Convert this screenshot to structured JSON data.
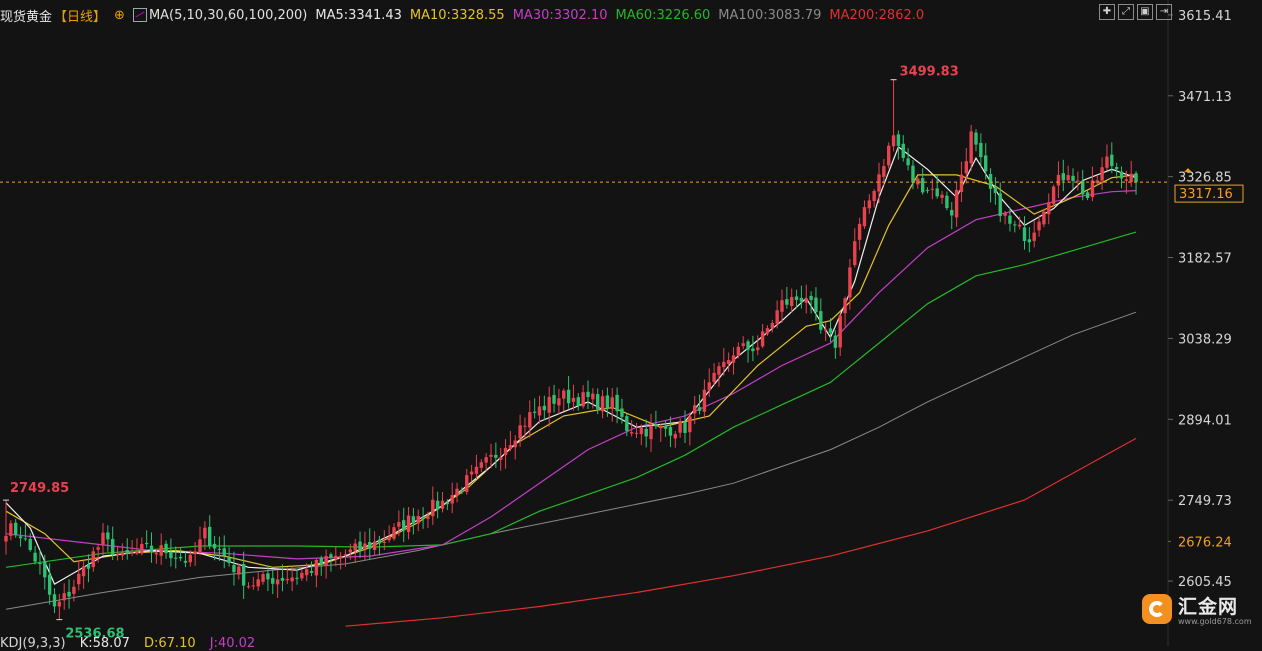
{
  "header": {
    "title": "现货黄金",
    "period": "【日线】",
    "add_symbol": "⊕",
    "ma_label": "MA(5,10,30,60,100,200)",
    "ma5": "MA5:3341.43",
    "ma10": "MA10:3328.55",
    "ma30": "MA30:3302.10",
    "ma60": "MA60:3226.60",
    "ma100": "MA100:3083.79",
    "ma200": "MA200:2862.0"
  },
  "colors": {
    "background": "#131313",
    "up": "#e8424e",
    "down": "#2fbf71",
    "ma5": "#f0f0f0",
    "ma10": "#e6c229",
    "ma30": "#c53ec9",
    "ma60": "#25b825",
    "ma100": "#8a8a8a",
    "ma200": "#e0302f",
    "last_price": "#f0a020"
  },
  "toolbar": [
    "crosshair-icon",
    "expand-icon",
    "image-icon",
    "exit-icon"
  ],
  "kdj": {
    "label": "KDJ(9,3,3)",
    "k": "K:58.07",
    "d": "D:67.10",
    "j": "J:40.02"
  },
  "logo": {
    "name": "汇金网",
    "url": "www.gold678.com"
  },
  "chart_data": {
    "type": "candlestick",
    "ylim": [
      2536,
      3642
    ],
    "yticks": [
      3615.41,
      3471.13,
      3326.85,
      3182.57,
      3038.29,
      2894.01,
      2749.73,
      2605.45
    ],
    "ytick_labels": [
      "3615.41",
      "3471.13",
      "3326.85",
      "3182.57",
      "3038.29",
      "2894.01",
      "2749.73",
      "2605.45"
    ],
    "last_price": 3317.16,
    "last_price_label": "3317.16",
    "marker_price": 2676.24,
    "marker_price_label": "2676.24",
    "high_label": "3499.83",
    "high_value": 3499.83,
    "high_index": 183,
    "left_high_label": "2749.85",
    "left_high_value": 2749.85,
    "left_high_index": 0,
    "low_label": "2536.68",
    "low_value": 2536.68,
    "low_index": 11,
    "anchors": [
      [
        0,
        2700
      ],
      [
        3,
        2690
      ],
      [
        7,
        2630
      ],
      [
        10,
        2555
      ],
      [
        13,
        2585
      ],
      [
        17,
        2640
      ],
      [
        20,
        2680
      ],
      [
        24,
        2645
      ],
      [
        28,
        2660
      ],
      [
        33,
        2660
      ],
      [
        38,
        2640
      ],
      [
        41,
        2690
      ],
      [
        45,
        2650
      ],
      [
        50,
        2600
      ],
      [
        55,
        2610
      ],
      [
        60,
        2615
      ],
      [
        66,
        2640
      ],
      [
        72,
        2660
      ],
      [
        78,
        2680
      ],
      [
        84,
        2720
      ],
      [
        90,
        2745
      ],
      [
        96,
        2790
      ],
      [
        102,
        2840
      ],
      [
        108,
        2900
      ],
      [
        114,
        2935
      ],
      [
        120,
        2930
      ],
      [
        125,
        2920
      ],
      [
        128,
        2880
      ],
      [
        133,
        2875
      ],
      [
        140,
        2880
      ],
      [
        145,
        2950
      ],
      [
        150,
        3015
      ],
      [
        155,
        3025
      ],
      [
        160,
        3100
      ],
      [
        165,
        3115
      ],
      [
        168,
        3050
      ],
      [
        171,
        3030
      ],
      [
        175,
        3210
      ],
      [
        179,
        3310
      ],
      [
        183,
        3400
      ],
      [
        187,
        3320
      ],
      [
        192,
        3300
      ],
      [
        195,
        3265
      ],
      [
        199,
        3400
      ],
      [
        203,
        3300
      ],
      [
        207,
        3240
      ],
      [
        211,
        3220
      ],
      [
        215,
        3295
      ],
      [
        219,
        3340
      ],
      [
        223,
        3290
      ],
      [
        227,
        3355
      ],
      [
        233,
        3317
      ]
    ],
    "ma_lines": {
      "ma5": {
        "width": 1.2,
        "points": [
          [
            0,
            2745
          ],
          [
            5,
            2700
          ],
          [
            10,
            2600
          ],
          [
            14,
            2620
          ],
          [
            20,
            2650
          ],
          [
            30,
            2660
          ],
          [
            40,
            2655
          ],
          [
            50,
            2630
          ],
          [
            60,
            2625
          ],
          [
            70,
            2650
          ],
          [
            80,
            2690
          ],
          [
            90,
            2740
          ],
          [
            100,
            2810
          ],
          [
            110,
            2890
          ],
          [
            120,
            2925
          ],
          [
            130,
            2880
          ],
          [
            140,
            2890
          ],
          [
            150,
            3000
          ],
          [
            160,
            3070
          ],
          [
            165,
            3110
          ],
          [
            170,
            3040
          ],
          [
            175,
            3140
          ],
          [
            180,
            3290
          ],
          [
            184,
            3380
          ],
          [
            190,
            3340
          ],
          [
            196,
            3290
          ],
          [
            200,
            3360
          ],
          [
            205,
            3290
          ],
          [
            210,
            3240
          ],
          [
            216,
            3270
          ],
          [
            222,
            3320
          ],
          [
            228,
            3340
          ],
          [
            233,
            3325
          ]
        ]
      },
      "ma10": {
        "width": 1.2,
        "points": [
          [
            0,
            2730
          ],
          [
            8,
            2690
          ],
          [
            14,
            2640
          ],
          [
            25,
            2655
          ],
          [
            35,
            2660
          ],
          [
            45,
            2650
          ],
          [
            55,
            2630
          ],
          [
            65,
            2635
          ],
          [
            75,
            2665
          ],
          [
            85,
            2710
          ],
          [
            95,
            2770
          ],
          [
            105,
            2850
          ],
          [
            115,
            2900
          ],
          [
            125,
            2915
          ],
          [
            135,
            2880
          ],
          [
            145,
            2900
          ],
          [
            155,
            2990
          ],
          [
            165,
            3060
          ],
          [
            170,
            3070
          ],
          [
            176,
            3120
          ],
          [
            182,
            3240
          ],
          [
            188,
            3330
          ],
          [
            196,
            3330
          ],
          [
            204,
            3310
          ],
          [
            212,
            3260
          ],
          [
            220,
            3290
          ],
          [
            228,
            3325
          ],
          [
            233,
            3330
          ]
        ]
      },
      "ma30": {
        "width": 1.2,
        "points": [
          [
            0,
            2690
          ],
          [
            15,
            2675
          ],
          [
            30,
            2660
          ],
          [
            45,
            2655
          ],
          [
            60,
            2645
          ],
          [
            75,
            2650
          ],
          [
            90,
            2670
          ],
          [
            100,
            2720
          ],
          [
            110,
            2780
          ],
          [
            120,
            2840
          ],
          [
            130,
            2880
          ],
          [
            140,
            2900
          ],
          [
            150,
            2940
          ],
          [
            160,
            2990
          ],
          [
            170,
            3030
          ],
          [
            180,
            3120
          ],
          [
            190,
            3200
          ],
          [
            200,
            3250
          ],
          [
            210,
            3270
          ],
          [
            220,
            3290
          ],
          [
            228,
            3300
          ],
          [
            233,
            3302
          ]
        ]
      },
      "ma60": {
        "width": 1.2,
        "points": [
          [
            0,
            2630
          ],
          [
            20,
            2655
          ],
          [
            40,
            2668
          ],
          [
            60,
            2668
          ],
          [
            75,
            2666
          ],
          [
            90,
            2670
          ],
          [
            100,
            2690
          ],
          [
            110,
            2730
          ],
          [
            120,
            2760
          ],
          [
            130,
            2790
          ],
          [
            140,
            2830
          ],
          [
            150,
            2880
          ],
          [
            160,
            2920
          ],
          [
            170,
            2960
          ],
          [
            180,
            3030
          ],
          [
            190,
            3100
          ],
          [
            200,
            3150
          ],
          [
            210,
            3170
          ],
          [
            220,
            3195
          ],
          [
            233,
            3228
          ]
        ]
      },
      "ma100": {
        "width": 1.0,
        "points": [
          [
            0,
            2555
          ],
          [
            20,
            2585
          ],
          [
            40,
            2612
          ],
          [
            55,
            2625
          ],
          [
            70,
            2636
          ],
          [
            85,
            2660
          ],
          [
            100,
            2690
          ],
          [
            120,
            2725
          ],
          [
            140,
            2760
          ],
          [
            150,
            2780
          ],
          [
            160,
            2810
          ],
          [
            170,
            2840
          ],
          [
            180,
            2880
          ],
          [
            190,
            2925
          ],
          [
            200,
            2965
          ],
          [
            210,
            3005
          ],
          [
            220,
            3045
          ],
          [
            233,
            3085
          ]
        ]
      },
      "ma200": {
        "width": 1.2,
        "points": [
          [
            70,
            2525
          ],
          [
            90,
            2540
          ],
          [
            110,
            2560
          ],
          [
            130,
            2585
          ],
          [
            150,
            2615
          ],
          [
            170,
            2650
          ],
          [
            190,
            2695
          ],
          [
            210,
            2750
          ],
          [
            233,
            2860
          ]
        ]
      }
    }
  }
}
